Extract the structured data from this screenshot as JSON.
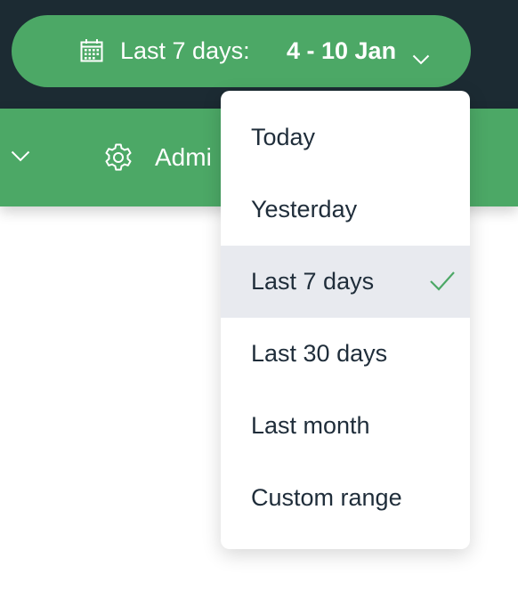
{
  "date_picker": {
    "label": "Last 7 days:",
    "range": "4 - 10 Jan"
  },
  "navbar": {
    "admin_label": "Admi"
  },
  "dropdown": {
    "items": [
      {
        "label": "Today",
        "selected": false
      },
      {
        "label": "Yesterday",
        "selected": false
      },
      {
        "label": "Last 7 days",
        "selected": true
      },
      {
        "label": "Last 30 days",
        "selected": false
      },
      {
        "label": "Last month",
        "selected": false
      },
      {
        "label": "Custom range",
        "selected": false
      }
    ]
  },
  "colors": {
    "topbar": "#1c2b33",
    "accent_green": "#4ca866",
    "selected_bg": "#e8eaef",
    "text_dark": "#1f2d3a"
  },
  "icons": {
    "date_picker": "calendar-icon",
    "date_picker_caret": "chevron-down-icon",
    "nav_caret": "chevron-down-icon",
    "admin": "gear-icon",
    "selected_marker": "check-icon"
  }
}
